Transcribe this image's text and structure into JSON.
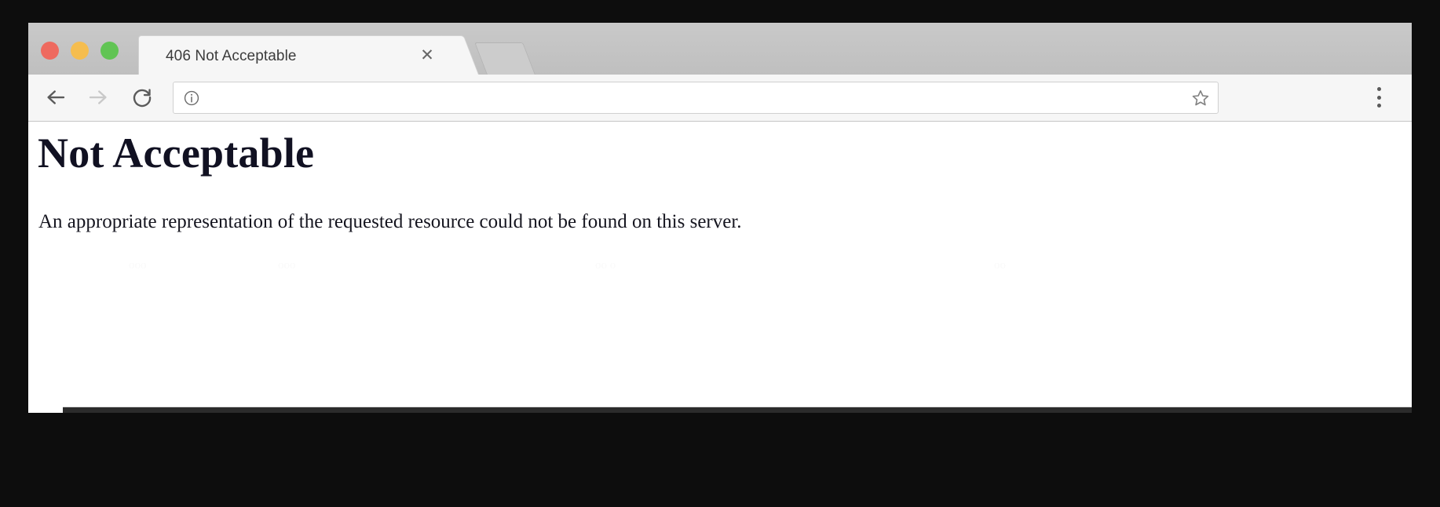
{
  "window": {
    "traffic_lights": [
      {
        "name": "close",
        "color": "#ee6a5f"
      },
      {
        "name": "minimize",
        "color": "#f5bd4f"
      },
      {
        "name": "maximize",
        "color": "#61c454"
      }
    ]
  },
  "tabs": {
    "active": {
      "title": "406 Not Acceptable",
      "close_label": "✕"
    },
    "new_tab_label": ""
  },
  "toolbar": {
    "back_label": "",
    "forward_label": "",
    "reload_label": "",
    "menu_label": "",
    "omnibox": {
      "value": "",
      "placeholder": "",
      "security_icon": "info-icon",
      "bookmark_icon": "star-outline-icon"
    }
  },
  "page": {
    "heading": "Not Acceptable",
    "paragraph": "An appropriate representation of the requested resource could not be found on this server."
  },
  "colors": {
    "tabstrip_bg": "#c4c4c4",
    "toolbar_bg": "#f6f6f6",
    "active_tab_bg": "#f6f6f6",
    "page_bg": "#ffffff",
    "frame": "#0d0d0d",
    "heading_text": "#111122",
    "body_text": "#15151f"
  }
}
